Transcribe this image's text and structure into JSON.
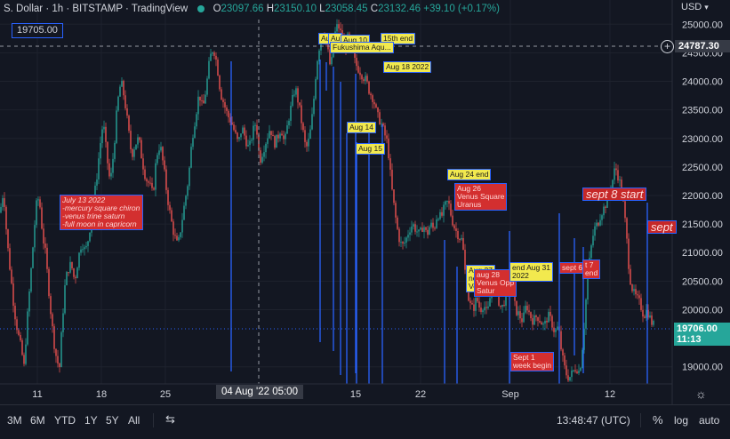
{
  "header": {
    "symbol": "S. Dollar",
    "interval": "1h",
    "exchange": "BITSTAMP",
    "platform": "TradingView",
    "o_label": "O",
    "o_value": "23097.66",
    "h_label": "H",
    "h_value": "23150.10",
    "l_label": "L",
    "l_value": "23058.45",
    "c_label": "C",
    "c_value": "23132.46",
    "change": "+39.10 (+0.17%)"
  },
  "price_box": "19705.00",
  "currency": "USD",
  "crosshair": {
    "time_label": "04 Aug '22  05:00",
    "price_label": "24787.30"
  },
  "last_price": {
    "value": "19706.00",
    "countdown": "11:13"
  },
  "bottom_bar": {
    "ranges": [
      "3M",
      "6M",
      "YTD",
      "1Y",
      "5Y",
      "All"
    ],
    "clock": "13:48:47 (UTC)",
    "percent": "%",
    "log": "log",
    "auto": "auto"
  },
  "colors": {
    "up": "#26a69a",
    "down": "#ef5350",
    "background": "#131722",
    "annotation_yellow": "#f2e94e",
    "annotation_red": "#d32f2f",
    "line_blue": "#2962ff"
  },
  "annotations": [
    {
      "text": "Aug 18 2022"
    },
    {
      "text": "Aug 14"
    },
    {
      "text": "Aug 15"
    },
    {
      "text": "Aug 24 end"
    },
    {
      "text": "Aug 26\nVenus Square\nUranus"
    },
    {
      "text": "July 13 2022\n-mercury square chiron\n-venus trine saturn\n-full moon in capricorn"
    },
    {
      "text": "15th end"
    },
    {
      "text": "Aug 27\nne\nVe"
    },
    {
      "text": "aug 28\nVenus Opp\nSatur"
    },
    {
      "text": "end Aug 31\n2022"
    },
    {
      "text": "sept 6"
    },
    {
      "text": "t 7\nend"
    },
    {
      "text": "Sept 1\nweek begin"
    },
    {
      "text": "sept 8 start"
    },
    {
      "text": "sept"
    },
    {
      "text": "Au"
    },
    {
      "text": "Au"
    },
    {
      "text": "Aug 10"
    },
    {
      "text": "Fukushima Aqu..."
    }
  ],
  "chart_data": {
    "type": "candlestick",
    "x_tick_labels": [
      "11",
      "18",
      "25",
      "15",
      "22",
      "Sep",
      "12"
    ],
    "y_tick_labels": [
      "25000.00",
      "24500.00",
      "24000.00",
      "23500.00",
      "23000.00",
      "22500.00",
      "22000.00",
      "21500.00",
      "21000.00",
      "20500.00",
      "20000.00",
      "19000.00"
    ],
    "ylim": [
      18700,
      25300
    ],
    "path": [
      [
        0,
        21700
      ],
      [
        4,
        22100
      ],
      [
        8,
        21200
      ],
      [
        12,
        20600
      ],
      [
        16,
        20000
      ],
      [
        20,
        19600
      ],
      [
        24,
        19300
      ],
      [
        27,
        19000
      ],
      [
        30,
        19700
      ],
      [
        33,
        20300
      ],
      [
        36,
        20900
      ],
      [
        39,
        21500
      ],
      [
        42,
        22000
      ],
      [
        45,
        21800
      ],
      [
        48,
        21300
      ],
      [
        51,
        21000
      ],
      [
        54,
        20500
      ],
      [
        58,
        19800
      ],
      [
        61,
        19400
      ],
      [
        64,
        19100
      ],
      [
        67,
        19000
      ],
      [
        70,
        19800
      ],
      [
        73,
        20400
      ],
      [
        76,
        20700
      ],
      [
        80,
        20800
      ],
      [
        84,
        20500
      ],
      [
        88,
        20900
      ],
      [
        92,
        21200
      ],
      [
        96,
        21000
      ],
      [
        100,
        21300
      ],
      [
        104,
        21800
      ],
      [
        108,
        22200
      ],
      [
        112,
        22800
      ],
      [
        116,
        23300
      ],
      [
        120,
        22700
      ],
      [
        124,
        22200
      ],
      [
        128,
        22800
      ],
      [
        132,
        23600
      ],
      [
        136,
        24000
      ],
      [
        140,
        23700
      ],
      [
        144,
        23200
      ],
      [
        148,
        22700
      ],
      [
        152,
        22900
      ],
      [
        156,
        23000
      ],
      [
        160,
        22600
      ],
      [
        164,
        22300
      ],
      [
        168,
        22200
      ],
      [
        172,
        22000
      ],
      [
        176,
        22700
      ],
      [
        180,
        22900
      ],
      [
        184,
        22500
      ],
      [
        188,
        22000
      ],
      [
        192,
        21600
      ],
      [
        196,
        21300
      ],
      [
        200,
        21100
      ],
      [
        204,
        21500
      ],
      [
        208,
        21900
      ],
      [
        212,
        22300
      ],
      [
        216,
        23000
      ],
      [
        220,
        23400
      ],
      [
        224,
        23800
      ],
      [
        228,
        23500
      ],
      [
        232,
        23900
      ],
      [
        236,
        24400
      ],
      [
        240,
        24600
      ],
      [
        244,
        24300
      ],
      [
        248,
        23800
      ],
      [
        252,
        23600
      ],
      [
        256,
        23400
      ],
      [
        260,
        23300
      ],
      [
        264,
        23100
      ],
      [
        268,
        22900
      ],
      [
        272,
        23200
      ],
      [
        276,
        23000
      ],
      [
        280,
        22800
      ],
      [
        284,
        23100
      ],
      [
        288,
        23300
      ],
      [
        292,
        22600
      ],
      [
        296,
        22800
      ],
      [
        300,
        23000
      ],
      [
        304,
        23200
      ],
      [
        308,
        22900
      ],
      [
        312,
        23000
      ],
      [
        316,
        23200
      ],
      [
        320,
        22900
      ],
      [
        324,
        23300
      ],
      [
        328,
        23600
      ],
      [
        332,
        23900
      ],
      [
        336,
        23600
      ],
      [
        340,
        23200
      ],
      [
        344,
        22800
      ],
      [
        348,
        23000
      ],
      [
        352,
        23500
      ],
      [
        356,
        24300
      ],
      [
        360,
        24700
      ],
      [
        364,
        24900
      ],
      [
        368,
        24600
      ],
      [
        372,
        24200
      ],
      [
        376,
        24800
      ],
      [
        380,
        25000
      ],
      [
        384,
        24800
      ],
      [
        388,
        24600
      ],
      [
        392,
        24800
      ],
      [
        396,
        24500
      ],
      [
        400,
        24300
      ],
      [
        404,
        24200
      ],
      [
        408,
        24100
      ],
      [
        412,
        24000
      ],
      [
        416,
        23800
      ],
      [
        420,
        23700
      ],
      [
        424,
        23400
      ],
      [
        428,
        23300
      ],
      [
        432,
        23100
      ],
      [
        436,
        22900
      ],
      [
        440,
        22200
      ],
      [
        444,
        21700
      ],
      [
        448,
        21300
      ],
      [
        452,
        21100
      ],
      [
        456,
        21200
      ],
      [
        460,
        21400
      ],
      [
        464,
        21500
      ],
      [
        468,
        21400
      ],
      [
        472,
        21300
      ],
      [
        476,
        21500
      ],
      [
        480,
        21300
      ],
      [
        484,
        21500
      ],
      [
        488,
        21400
      ],
      [
        492,
        21700
      ],
      [
        496,
        21600
      ],
      [
        500,
        21800
      ],
      [
        504,
        21900
      ],
      [
        508,
        21600
      ],
      [
        512,
        21400
      ],
      [
        516,
        21300
      ],
      [
        520,
        21200
      ],
      [
        524,
        20500
      ],
      [
        528,
        20100
      ],
      [
        532,
        20000
      ],
      [
        536,
        20200
      ],
      [
        540,
        20000
      ],
      [
        544,
        20100
      ],
      [
        548,
        19900
      ],
      [
        552,
        20300
      ],
      [
        556,
        20500
      ],
      [
        560,
        20200
      ],
      [
        564,
        20000
      ],
      [
        568,
        20200
      ],
      [
        572,
        20500
      ],
      [
        576,
        20300
      ],
      [
        580,
        20000
      ],
      [
        584,
        19900
      ],
      [
        588,
        19800
      ],
      [
        592,
        20100
      ],
      [
        596,
        19900
      ],
      [
        600,
        19800
      ],
      [
        604,
        19900
      ],
      [
        608,
        19800
      ],
      [
        612,
        19700
      ],
      [
        616,
        19900
      ],
      [
        620,
        19800
      ],
      [
        624,
        19600
      ],
      [
        628,
        19700
      ],
      [
        632,
        19200
      ],
      [
        636,
        18900
      ],
      [
        640,
        18800
      ],
      [
        644,
        18900
      ],
      [
        648,
        19000
      ],
      [
        652,
        18900
      ],
      [
        656,
        19500
      ],
      [
        660,
        20400
      ],
      [
        664,
        21000
      ],
      [
        668,
        21400
      ],
      [
        672,
        21500
      ],
      [
        676,
        21700
      ],
      [
        680,
        21800
      ],
      [
        684,
        22000
      ],
      [
        688,
        22200
      ],
      [
        692,
        22500
      ],
      [
        696,
        22300
      ],
      [
        700,
        22000
      ],
      [
        704,
        21400
      ],
      [
        708,
        20600
      ],
      [
        712,
        20300
      ],
      [
        716,
        20200
      ],
      [
        720,
        20100
      ],
      [
        724,
        19900
      ],
      [
        728,
        20000
      ],
      [
        732,
        19800
      ],
      [
        736,
        19706
      ]
    ]
  }
}
